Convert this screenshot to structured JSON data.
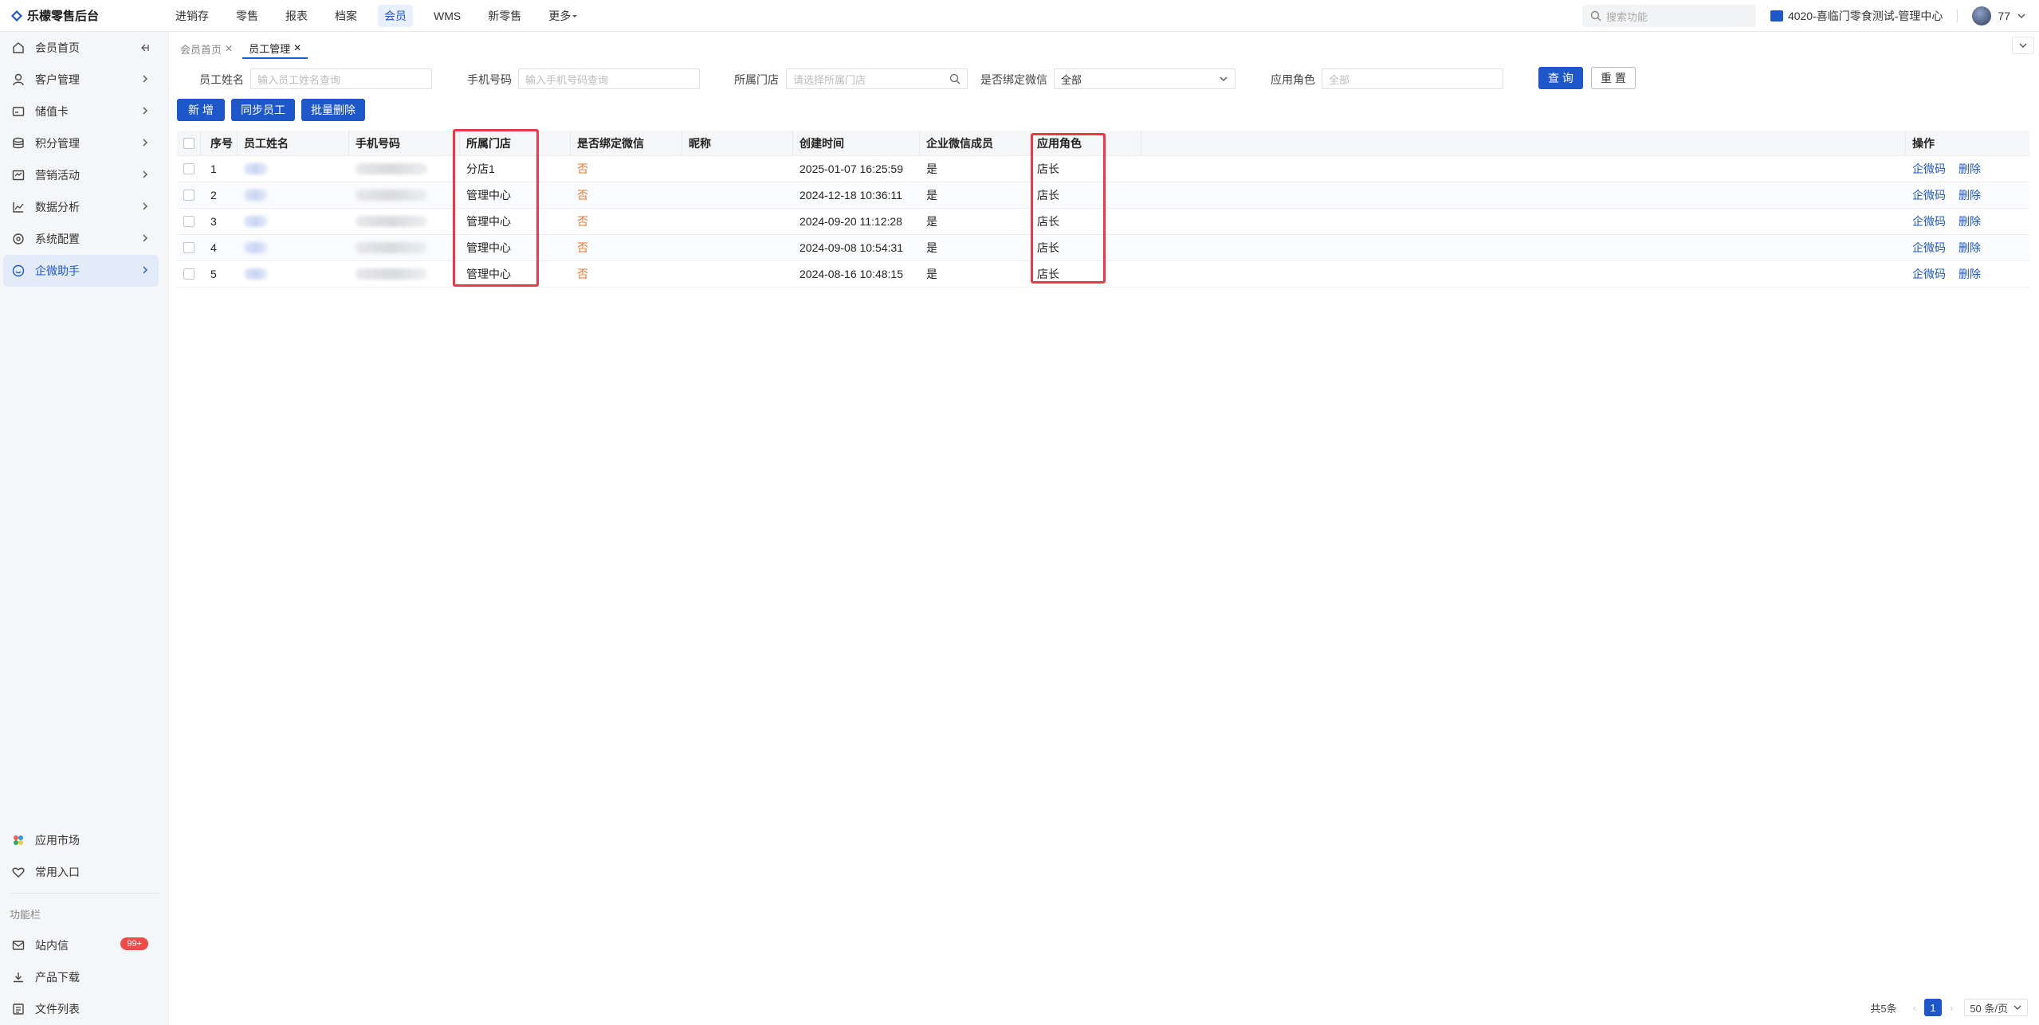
{
  "app": {
    "title": "乐檬零售后台"
  },
  "topnav": {
    "items": [
      {
        "label": "进销存",
        "active": false
      },
      {
        "label": "零售",
        "active": false
      },
      {
        "label": "报表",
        "active": false
      },
      {
        "label": "档案",
        "active": false
      },
      {
        "label": "会员",
        "active": true
      },
      {
        "label": "WMS",
        "active": false
      },
      {
        "label": "新零售",
        "active": false
      }
    ],
    "more_label": "更多",
    "search_placeholder": "搜索功能",
    "store": "4020-喜临门零食测试-管理中心",
    "user": "77"
  },
  "sidebar": {
    "items": [
      {
        "label": "会员首页",
        "icon": "home-icon"
      },
      {
        "label": "客户管理",
        "icon": "user-icon"
      },
      {
        "label": "储值卡",
        "icon": "card-icon"
      },
      {
        "label": "积分管理",
        "icon": "coins-icon"
      },
      {
        "label": "营销活动",
        "icon": "campaign-icon"
      },
      {
        "label": "数据分析",
        "icon": "chart-icon"
      },
      {
        "label": "系统配置",
        "icon": "settings-icon"
      },
      {
        "label": "企微助手",
        "icon": "chat-icon",
        "active": true
      }
    ],
    "bottom": {
      "market": "应用市场",
      "favorites": "常用入口",
      "section": "功能栏",
      "inbox": "站内信",
      "inbox_badge": "99+",
      "download": "产品下载",
      "files": "文件列表"
    }
  },
  "tabs": [
    {
      "label": "会员首页",
      "active": false
    },
    {
      "label": "员工管理",
      "active": true
    }
  ],
  "filters": {
    "name_label": "员工姓名",
    "name_placeholder": "输入员工姓名查询",
    "phone_label": "手机号码",
    "phone_placeholder": "输入手机号码查询",
    "store_label": "所属门店",
    "store_placeholder": "请选择所属门店",
    "wx_label": "是否绑定微信",
    "wx_value": "全部",
    "role_label": "应用角色",
    "role_placeholder": "全部",
    "query": "查 询",
    "reset": "重 置"
  },
  "actions": {
    "add": "新 增",
    "sync": "同步员工",
    "batch_delete": "批量删除"
  },
  "table": {
    "columns": {
      "index": "序号",
      "name": "员工姓名",
      "phone": "手机号码",
      "store": "所属门店",
      "wx": "是否绑定微信",
      "nick": "昵称",
      "created": "创建时间",
      "member": "企业微信成员",
      "role": "应用角色",
      "ops": "操作"
    },
    "rows": [
      {
        "index": "1",
        "store": "分店1",
        "wx": "否",
        "created": "2025-01-07 16:25:59",
        "member": "是",
        "role": "店长",
        "op1": "企微码",
        "op2": "删除"
      },
      {
        "index": "2",
        "store": "管理中心",
        "wx": "否",
        "created": "2024-12-18 10:36:11",
        "member": "是",
        "role": "店长",
        "op1": "企微码",
        "op2": "删除"
      },
      {
        "index": "3",
        "store": "管理中心",
        "wx": "否",
        "created": "2024-09-20 11:12:28",
        "member": "是",
        "role": "店长",
        "op1": "企微码",
        "op2": "删除"
      },
      {
        "index": "4",
        "store": "管理中心",
        "wx": "否",
        "created": "2024-09-08 10:54:31",
        "member": "是",
        "role": "店长",
        "op1": "企微码",
        "op2": "删除"
      },
      {
        "index": "5",
        "store": "管理中心",
        "wx": "否",
        "created": "2024-08-16 10:48:15",
        "member": "是",
        "role": "店长",
        "op1": "企微码",
        "op2": "删除"
      }
    ]
  },
  "pagination": {
    "total": "共5条",
    "current": "1",
    "page_size": "50 条/页"
  },
  "colors": {
    "accent": "#1e57c9",
    "highlight": "#f0364a",
    "warn": "#e6772e"
  }
}
